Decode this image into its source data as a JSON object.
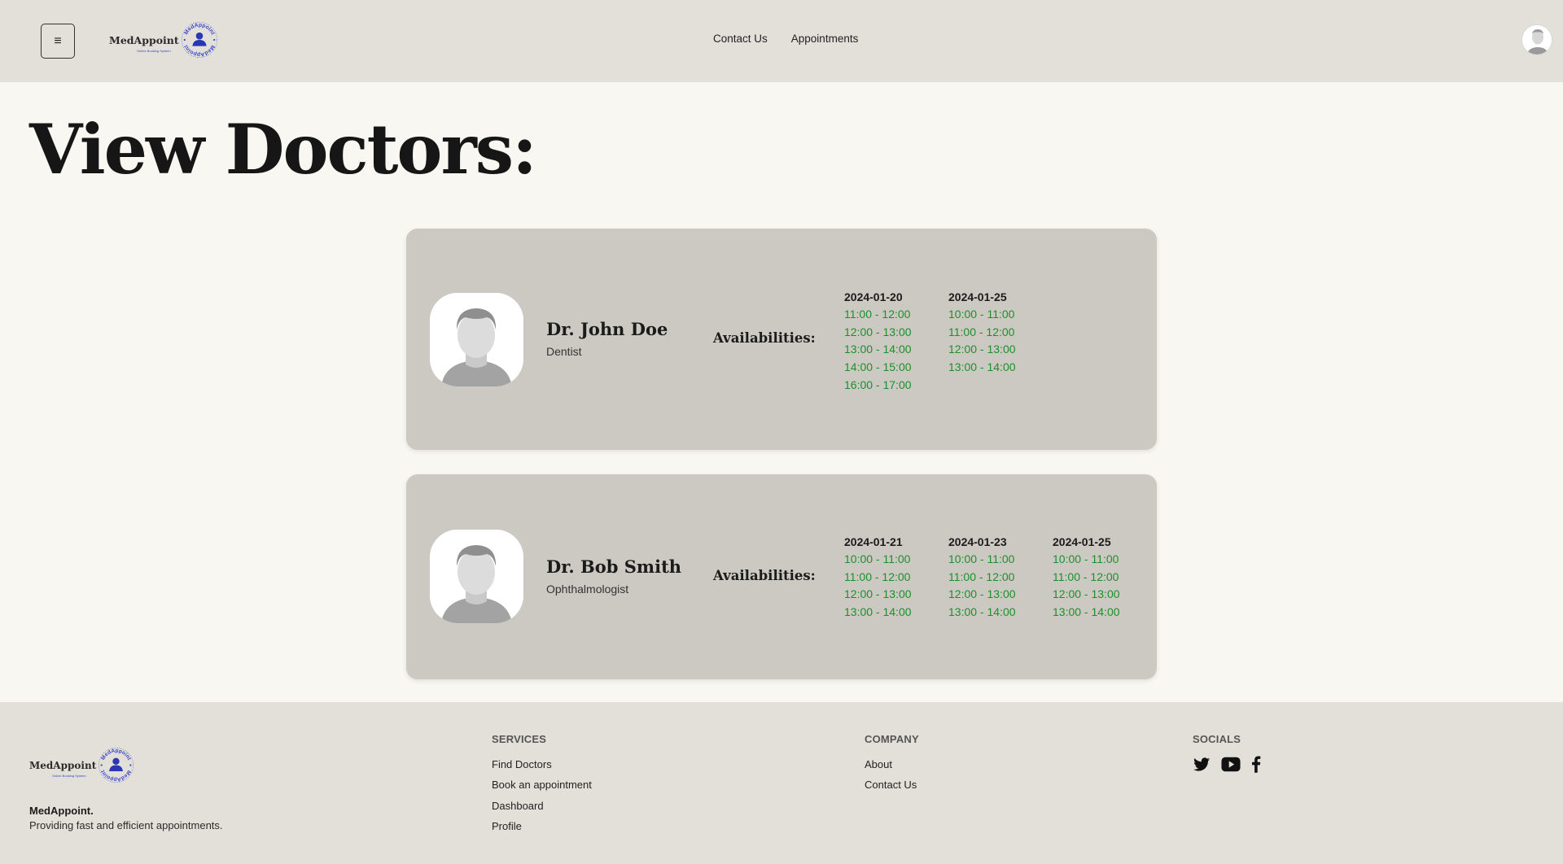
{
  "header": {
    "brand": "MedAppoint",
    "brand_tagline": "Online Booking System",
    "seal_text": "MedAppoint",
    "menu_glyph": "≡",
    "nav": [
      {
        "label": "Contact Us"
      },
      {
        "label": "Appointments"
      }
    ]
  },
  "page": {
    "title": "View Doctors:"
  },
  "doctors": [
    {
      "name": "Dr. John Doe",
      "specialty": "Dentist",
      "availabilities_label": "Availabilities:",
      "days": [
        {
          "date": "2024-01-20",
          "slots": [
            "11:00 - 12:00",
            "12:00 - 13:00",
            "13:00 - 14:00",
            "14:00 - 15:00",
            "16:00 - 17:00"
          ]
        },
        {
          "date": "2024-01-25",
          "slots": [
            "10:00 - 11:00",
            "11:00 - 12:00",
            "12:00 - 13:00",
            "13:00 - 14:00"
          ]
        }
      ]
    },
    {
      "name": "Dr. Bob Smith",
      "specialty": "Ophthalmologist",
      "availabilities_label": "Availabilities:",
      "days": [
        {
          "date": "2024-01-21",
          "slots": [
            "10:00 - 11:00",
            "11:00 - 12:00",
            "12:00 - 13:00",
            "13:00 - 14:00"
          ]
        },
        {
          "date": "2024-01-23",
          "slots": [
            "10:00 - 11:00",
            "11:00 - 12:00",
            "12:00 - 13:00",
            "13:00 - 14:00"
          ]
        },
        {
          "date": "2024-01-25",
          "slots": [
            "10:00 - 11:00",
            "11:00 - 12:00",
            "12:00 - 13:00",
            "13:00 - 14:00"
          ]
        }
      ]
    }
  ],
  "footer": {
    "brand": "MedAppoint",
    "brand_tagline": "Online Booking System",
    "seal_text": "MedAppoint",
    "brand_name": "MedAppoint.",
    "brand_tag": "Providing fast and efficient appointments.",
    "services": {
      "heading": "SERVICES",
      "links": [
        "Find Doctors",
        "Book an appointment",
        "Dashboard",
        "Profile"
      ]
    },
    "company": {
      "heading": "COMPANY",
      "links": [
        "About",
        "Contact Us"
      ]
    },
    "socials": {
      "heading": "SOCIALS",
      "icons": [
        "twitter-icon",
        "youtube-icon",
        "facebook-icon"
      ]
    }
  },
  "colors": {
    "header_bg": "#e3e0da",
    "page_bg": "#f9f7f1",
    "card_bg": "#ccc9c3",
    "slot_green": "#1d8f2a",
    "logo_blue": "#3a45c8"
  }
}
